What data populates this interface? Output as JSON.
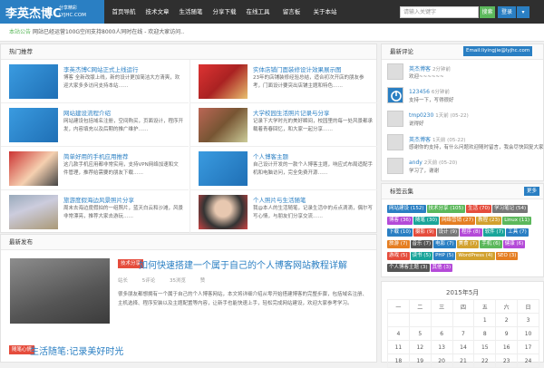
{
  "header": {
    "logo_cn": "李英杰博C",
    "logo_sub1": "分享精彩",
    "logo_sub2": "LYJHC.COM",
    "nav": [
      "首页导航",
      "技术文章",
      "生活随笔",
      "分享下载",
      "在线工具",
      "留言板",
      "关于本站"
    ],
    "search_placeholder": "请输入关键字",
    "search_button": "搜索",
    "user_button": "登录",
    "user_caret": "▾"
  },
  "announcement": {
    "prefix": "本站公告",
    "text": "网站已经运营100G空间支持8000人同时在线 - 欢迎大家访问.."
  },
  "hot": {
    "title": "热门推荐",
    "items": [
      {
        "title": "李英杰博C网站正式上线运行",
        "desc": "博客 全新改版上线，新的设计更加简洁大方清爽，欢迎大家多多访问支持本站……"
      },
      {
        "title": "实体店铺门面装修设计效果展示图",
        "desc": "23年的店铺装修经验总结，适合初次开店的朋友参考，门面设计要突出店铺主题和特色……"
      },
      {
        "title": "网站建设流程介绍",
        "desc": "网站建设包括域名注册，空间购买，页面设计，程序开发，内容填充以及后期的推广维护……"
      },
      {
        "title": "大学校园生活照片记录与分享",
        "desc": "记录下大学时光的美好瞬间，校园里的每一处风景都承载着青春回忆，和大家一起分享……"
      },
      {
        "title": "简单好用的手机应用推荐",
        "desc": "这几款手机应用都非常实用，支持VPN网络加速和文件管理，推荐给需要的朋友下载……"
      },
      {
        "title": "个人博客主题",
        "desc": "自己设计开发的一款个人博客主题，响应式布局适配手机和电脑访问，完全免费开源……"
      },
      {
        "title": "旅游度假海边风景照片分享",
        "desc": "周末去海边度假拍的一组照片，蓝天白云和沙滩，风景非常漂亮，推荐大家去游玩……"
      },
      {
        "title": "个人照片与生活随笔",
        "desc": "我@本人的生活随笔，记录生活中的点点滴滴，偶尔写写心情，与朋友们分享交流……"
      }
    ]
  },
  "latest": {
    "title": "最新发布",
    "posts": [
      {
        "badge": "技术分享",
        "title": "如何快速搭建一个属于自己的个人博客网站教程详解",
        "meta_author": "站长",
        "meta_comments": "5评论",
        "meta_views": "35浏览",
        "meta_likes": "赞",
        "body": "很多朋友都想拥有一个属于自己的个人博客网站，本文将详细介绍从零开始搭建博客的完整步骤，包括域名注册、主机选择、程序安装以及主题配置等内容，让新手也能快速上手，轻松完成网站建设，欢迎大家参考学习。"
      },
      {
        "badge": "随笔心情",
        "title": "生活随笔:记录美好时光"
      }
    ]
  },
  "comments": {
    "title": "最新评论",
    "email": "Email:liyingjie@lyjhc.com",
    "items": [
      {
        "name": "英杰博客",
        "time": "2分钟前",
        "text": "欢迎~~~~~~"
      },
      {
        "name": "123456",
        "time": "6分钟前",
        "text": "支持一下，写得很好"
      },
      {
        "name": "tmp0230",
        "time": "1天前 (05-22)",
        "text": "说得好"
      },
      {
        "name": "英杰博客",
        "time": "1天前 (05-22)",
        "text": "感谢你的支持，有什么问题欢迎随时留言，我会尽快回复大家"
      },
      {
        "name": "andy",
        "time": "2天前 (05-20)",
        "text": "学习了，谢谢"
      }
    ]
  },
  "tags": {
    "title": "标签云集",
    "more": "更多",
    "items": [
      {
        "label": "网站建设 (152)",
        "color": "#2a7fc3"
      },
      {
        "label": "技术分享 (105)",
        "color": "#5cb85c"
      },
      {
        "label": "生活 (70)",
        "color": "#e54c3c"
      },
      {
        "label": "学习笔记 (54)",
        "color": "#777777"
      },
      {
        "label": "博客 (36)",
        "color": "#b44ad8"
      },
      {
        "label": "随笔 (30)",
        "color": "#1aa59a"
      },
      {
        "label": "网络营销 (27)",
        "color": "#e57e22"
      },
      {
        "label": "教程 (23)",
        "color": "#d2a12e"
      },
      {
        "label": "Linux (11)",
        "color": "#5cb85c"
      },
      {
        "label": "下载 (10)",
        "color": "#2a7fc3"
      },
      {
        "label": "摄影 (9)",
        "color": "#e54c3c"
      },
      {
        "label": "设计 (9)",
        "color": "#777777"
      },
      {
        "label": "程序 (8)",
        "color": "#b44ad8"
      },
      {
        "label": "软件 (7)",
        "color": "#1aa59a"
      },
      {
        "label": "工具 (7)",
        "color": "#2a7fc3"
      },
      {
        "label": "旅游 (7)",
        "color": "#e57e22"
      },
      {
        "label": "音乐 (7)",
        "color": "#555555"
      },
      {
        "label": "电影 (7)",
        "color": "#2a7fc3"
      },
      {
        "label": "美食 (7)",
        "color": "#d2a12e"
      },
      {
        "label": "手机 (6)",
        "color": "#5cb85c"
      },
      {
        "label": "健康 (6)",
        "color": "#b44ad8"
      },
      {
        "label": "游戏 (5)",
        "color": "#e54c3c"
      },
      {
        "label": "读书 (5)",
        "color": "#1aa59a"
      },
      {
        "label": "PHP (5)",
        "color": "#2a7fc3"
      },
      {
        "label": "WordPress (4)",
        "color": "#d2a12e"
      },
      {
        "label": "SEO (3)",
        "color": "#e57e22"
      },
      {
        "label": "个人博客主题 (3)",
        "color": "#555555"
      },
      {
        "label": "其他 (3)",
        "color": "#b44ad8"
      }
    ]
  },
  "calendar": {
    "title": "2015年5月",
    "weekdays": [
      "一",
      "二",
      "三",
      "四",
      "五",
      "六",
      "日"
    ],
    "rows": [
      [
        "",
        "",
        "",
        "",
        "1",
        "2",
        "3"
      ],
      [
        "4",
        "5",
        "6",
        "7",
        "8",
        "9",
        "10"
      ],
      [
        "11",
        "12",
        "13",
        "14",
        "15",
        "16",
        "17"
      ],
      [
        "18",
        "19",
        "20",
        "21",
        "22",
        "23",
        "24"
      ]
    ]
  }
}
